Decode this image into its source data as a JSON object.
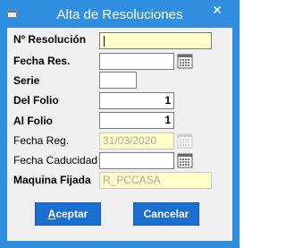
{
  "window": {
    "title": "Alta de Resoluciones",
    "close_symbol": "✕"
  },
  "form": {
    "resolucion": {
      "label": "Nº Resolución",
      "value": ""
    },
    "fecha_res": {
      "label": "Fecha Res.",
      "value": ""
    },
    "serie": {
      "label": "Serie",
      "value": ""
    },
    "del_folio": {
      "label": "Del Folio",
      "value": "1"
    },
    "al_folio": {
      "label": "Al Folio",
      "value": "1"
    },
    "fecha_reg": {
      "label": "Fecha Reg.",
      "value": "31/03/2020"
    },
    "fecha_caducidad": {
      "label": "Fecha Caducidad",
      "value": ""
    },
    "maquina_fijada": {
      "label": "Maquina Fijada",
      "value": "R_PCCASA"
    }
  },
  "buttons": {
    "aceptar_mnemonic": "A",
    "aceptar_rest": "ceptar",
    "cancelar": "Cancelar"
  },
  "colors": {
    "titlebar": "#2f8ee0",
    "button": "#1a6fd1",
    "highlight_field": "#ffffc8"
  },
  "icons": {
    "calendar": "calendar-icon",
    "close": "close-icon",
    "app": "app-icon"
  }
}
